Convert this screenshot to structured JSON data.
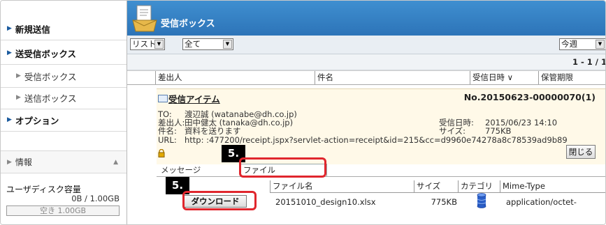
{
  "sidebar": {
    "items": [
      {
        "label": "新規送信",
        "sub": false
      },
      {
        "label": "送受信ボックス",
        "sub": false
      },
      {
        "label": "受信ボックス",
        "sub": true
      },
      {
        "label": "送信ボックス",
        "sub": true
      },
      {
        "label": "オプション",
        "sub": false
      }
    ],
    "info_label": "情報",
    "disk_label": "ユーザディスク容量",
    "disk_usage": "0B / 1.00GB",
    "disk_free": "空き 1.00GB",
    "disk_used_fraction": 0
  },
  "header": {
    "title": "受信ボックス"
  },
  "toolbar": {
    "view_select": "リスト",
    "filter_select": "全て",
    "period_select": "今週"
  },
  "pager": {
    "text": "1 - 1 / 1"
  },
  "columns": {
    "sender": "差出人",
    "subject": "件名",
    "received": "受信日時 ∨",
    "retention": "保管期限"
  },
  "detail": {
    "title": "受信アイテム",
    "message_no": "No.20150623-00000070(1)",
    "to_label": "TO:",
    "to_value": "渡辺誠 (watanabe@dh.co.jp)",
    "from_label": "差出人:",
    "from_value": "田中健太 (tanaka@dh.co.jp)",
    "subject_label": "件名:",
    "subject_value": "資料を送ります",
    "url_label": "URL:",
    "url_value": "http:   :477200/receipt.jspx?servlet-action=receipt&id=215&cc=d9960e74278a8c78539ad9b89",
    "received_label": "受信日時:",
    "received_value": "2015/06/23 14:10",
    "size_label": "サイズ:",
    "size_value": "775KB",
    "close_label": "閉じる"
  },
  "tabs": {
    "message": "メッセージ",
    "file": "ファイル"
  },
  "file_table": {
    "headers": [
      "ファイル名",
      "サイズ",
      "カテゴリ",
      "Mime-Type"
    ],
    "download_label": "ダウンロード",
    "row": {
      "name": "20151010_design10.xlsx",
      "size": "775KB",
      "mime": "application/octet-"
    }
  },
  "callouts": {
    "first": "5.",
    "second": "5."
  },
  "colors": {
    "title_bar": "#2d74b8",
    "callout_border": "#e0262d",
    "detail_bg": "#fff9e8"
  }
}
